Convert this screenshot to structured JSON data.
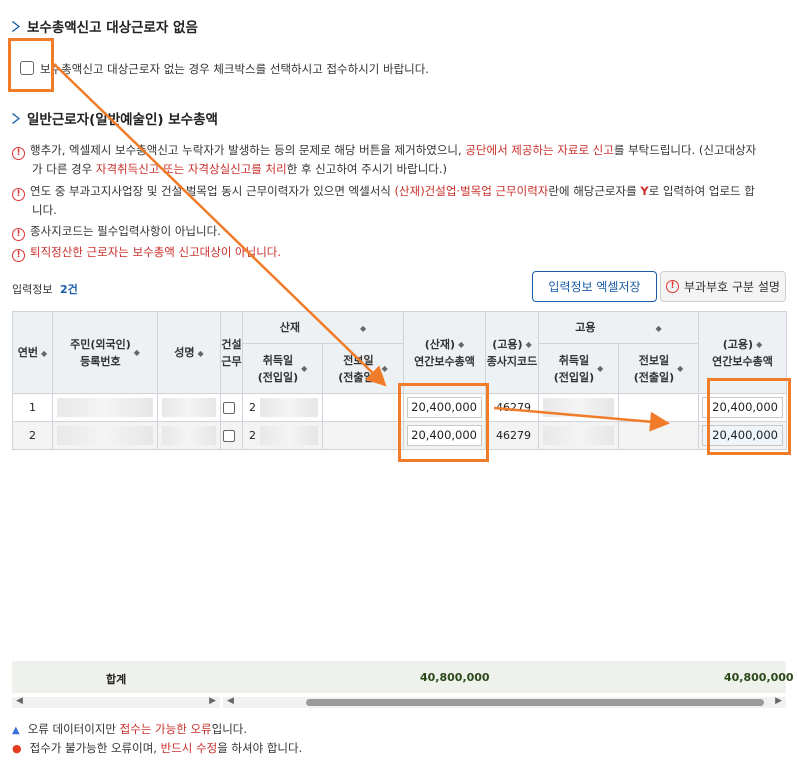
{
  "section1": {
    "title": "보수총액신고 대상근로자 없음",
    "checkbox_label": "보수총액신고 대상근로자 없는 경우 체크박스를 선택하시고 접수하시기 바랍니다."
  },
  "section2": {
    "title": "일반근로자(일반예술인) 보수총액",
    "notices": {
      "n1_a": "행추가, 엑셀제시 보수총액신고 누락자가 발생하는 등의 문제로 해당 버튼을 제거하였으니, ",
      "n1_red1": "공단에서 제공하는 자료로 신고",
      "n1_b": "를 부탁드립니다. (신고대상자",
      "n1_c": "가 다른 경우 ",
      "n1_red2": "자격취득신고 또는 자격상실신고를 처리",
      "n1_d": "한 후 신고하여 주시기 바랍니다.)",
      "n2_a": "연도 중 부과고지사업장 및 건설·벌목업 동시 근무이력자가 있으면 엑셀서식 ",
      "n2_red": "(산재)건설업·벌목업 근무이력자",
      "n2_b": "란에 해당근로자를 ",
      "n2_y": "Y",
      "n2_c": "로 입력하여 업로드 합",
      "n2_d": "니다.",
      "n3": "종사지코드는 필수입력사항이 아닙니다.",
      "n4": "퇴직정산한 근로자는 보수총액 신고대상이 아닙니다."
    }
  },
  "input_info": {
    "label": "입력정보",
    "count": "2건"
  },
  "buttons": {
    "excel": "입력정보 엑셀저장",
    "explain": "부과부호 구분 설명"
  },
  "table": {
    "headers": {
      "year_month": "연번",
      "rrn_line1": "주민(외국인)",
      "rrn_line2": "등록번호",
      "name": "성명",
      "construction_1": "건설",
      "construction_2": "근무",
      "group_sanjae": "산재",
      "acq_1": "취득일",
      "acq_2": "(전입일)",
      "loss_1": "전보일",
      "loss_2": "(전출일)",
      "sanjae_total_1": "(산재)",
      "sanjae_total_2": "연간보수총액",
      "goyong_code_1": "(고용)",
      "goyong_code_2": "종사지코드",
      "group_goyong": "고용",
      "g_acq_1": "취득일",
      "g_acq_2": "(전입일)",
      "g_loss_1": "전보일",
      "g_loss_2": "(전출일)",
      "goyong_total_1": "(고용)",
      "goyong_total_2": "연간보수총액"
    },
    "rows": [
      {
        "no": "1",
        "const_prefix": "2",
        "sanjae_total": "20,400,000",
        "code": "46279",
        "goyong_total": "20,400,000"
      },
      {
        "no": "2",
        "const_prefix": "2",
        "sanjae_total": "20,400,000",
        "code": "46279",
        "goyong_total": "20,400,000"
      }
    ],
    "footer": {
      "label": "합계",
      "sanjae_sum": "40,800,000",
      "goyong_sum": "40,800,000"
    }
  },
  "legend": {
    "item1_a": "오류 데이터이지만 ",
    "item1_red": "접수는 가능한 오류",
    "item1_b": "입니다.",
    "item2_a": "접수가 불가능한 오류이며, ",
    "item2_red": "반드시 수정",
    "item2_b": "을 하셔야 합니다."
  },
  "colors": {
    "accent": "#1b5ea8",
    "warn": "#c9302c",
    "highlight": "#f07c2a"
  }
}
